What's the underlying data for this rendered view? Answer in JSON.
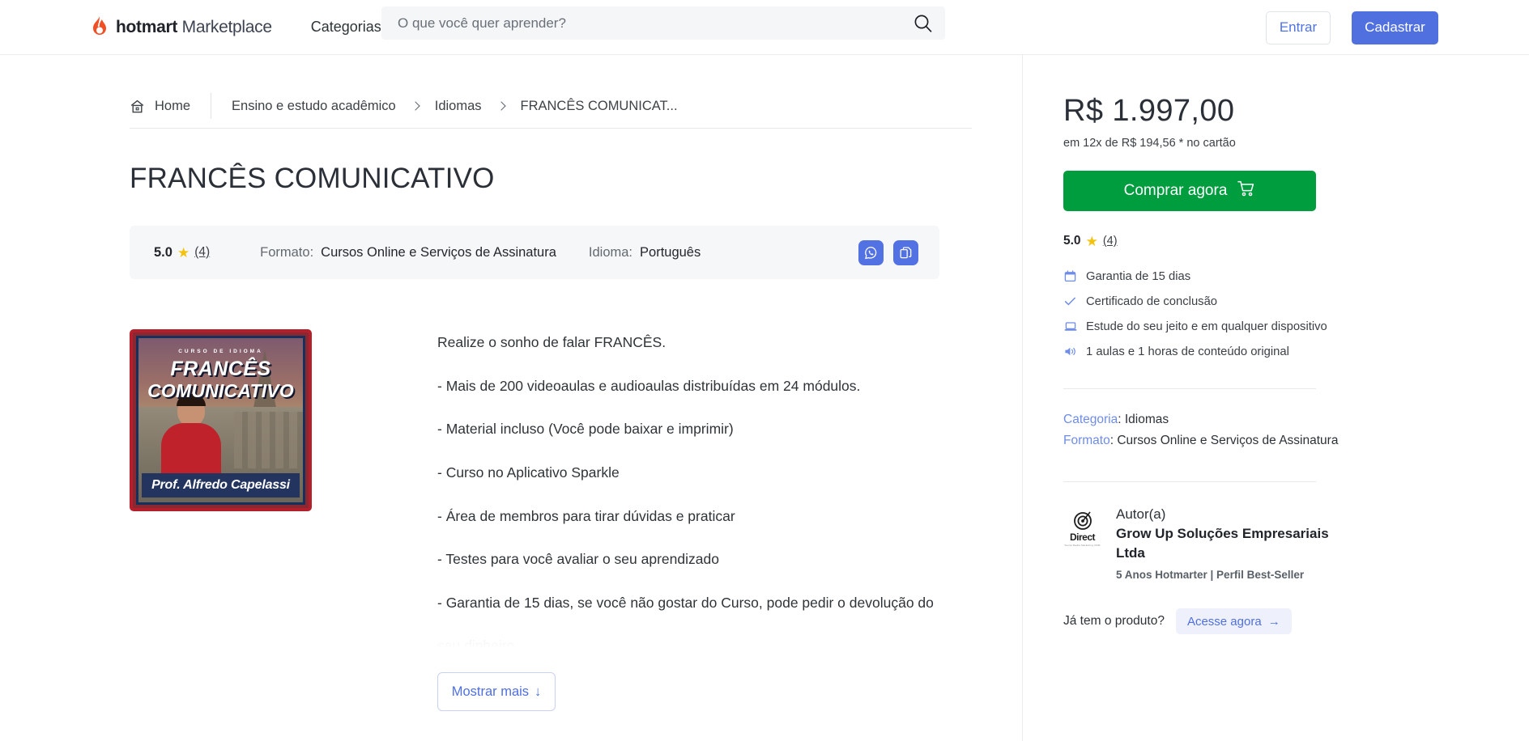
{
  "header": {
    "brand_bold": "hotmart",
    "brand_light": "Marketplace",
    "categories_label": "Categorias",
    "search_placeholder": "O que você quer aprender?",
    "search_value": "",
    "login_label": "Entrar",
    "signup_label": "Cadastrar",
    "accent_blue": "#5070e0"
  },
  "breadcrumb": {
    "home": "Home",
    "items": [
      "Ensino e estudo acadêmico",
      "Idiomas",
      "FRANCÊS COMUNICAT..."
    ]
  },
  "product": {
    "title": "FRANCÊS COMUNICATIVO",
    "rating_value": "5.0",
    "rating_count": "(4)",
    "format_label": "Formato:",
    "format_value": "Cursos Online e Serviços de Assinatura",
    "language_label": "Idioma:",
    "language_value": "Português",
    "share_whatsapp": "whatsapp-share",
    "share_copy": "copy-link"
  },
  "thumbnail": {
    "eyebrow": "CURSO DE IDIOMA",
    "line1": "FRANCÊS",
    "line2": "COMUNICATIVO",
    "author_bar": "Prof. Alfredo Capelassi"
  },
  "description": {
    "paragraphs": [
      "Realize o sonho de falar FRANCÊS.",
      "- Mais de 200 videoaulas e audioaulas distribuídas em 24 módulos.",
      "- Material incluso (Você pode baixar e imprimir)",
      "- Curso no Aplicativo Sparkle",
      "- Área de membros para tirar dúvidas e praticar",
      "- Testes para você avaliar o seu aprendizado",
      "- Garantia de 15 dias, se você não gostar do Curso, pode pedir o devolução do"
    ],
    "faded_line": "seu dinheiro.",
    "show_more_label": "Mostrar mais",
    "show_more_icon": "arrow-down-icon"
  },
  "sidebar": {
    "price": "R$ 1.997,00",
    "installment": "em 12x de R$ 194,56 * no cartão",
    "buy_label": "Comprar agora",
    "buy_icon": "cart-icon",
    "buy_color": "#009d3f",
    "rating_value": "5.0",
    "rating_count": "(4)",
    "benefits": [
      {
        "icon": "calendar-icon",
        "text": "Garantia de 15 dias"
      },
      {
        "icon": "check-icon",
        "text": "Certificado de conclusão"
      },
      {
        "icon": "laptop-icon",
        "text": "Estude do seu jeito e em qualquer dispositivo"
      },
      {
        "icon": "speaker-icon",
        "text": "1 aulas e 1 horas de conteúdo original"
      }
    ],
    "meta": {
      "category_label": "Categoria",
      "category_value": ": Idiomas",
      "format_label": "Formato",
      "format_value": ": Cursos Online e Serviços de Assinatura"
    },
    "author": {
      "logo_text": "Direct",
      "logo_sub": "Social Media Marketing CRM",
      "label": "Autor(a)",
      "name": "Grow Up Soluções Empresariais Ltda",
      "tag": "5 Anos Hotmarter | Perfil Best-Seller"
    },
    "have_product_label": "Já tem o produto?",
    "access_label": "Acesse agora",
    "access_icon": "arrow-right-icon"
  }
}
